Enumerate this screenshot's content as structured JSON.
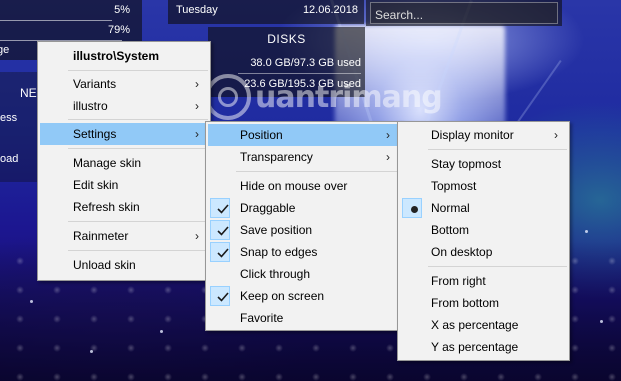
{
  "colors": {
    "menu_bg": "#f2f2f2",
    "highlight": "#91c9f7",
    "check_bg": "#cce8ff",
    "skin_bg": "#14141a"
  },
  "desktop": {
    "system_skin": {
      "rows": [
        {
          "key": "",
          "value": "5%"
        },
        {
          "key": "",
          "value": "79%"
        },
        {
          "key": "ge",
          "value": ""
        }
      ]
    },
    "net_skin": {
      "title": "NE",
      "lines": [
        "ess",
        "oad"
      ]
    },
    "date_skin": {
      "day": "Tuesday",
      "date": "12.06.2018"
    },
    "search_skin": {
      "placeholder": "Search..."
    },
    "disks_skin": {
      "title": "DISKS",
      "lines": [
        "38.0 GB/97.3 GB used",
        "23.6 GB/195.3 GB used"
      ]
    },
    "watermark": {
      "text": "uantrimang"
    }
  },
  "context_menu": {
    "title": "illustro\\System",
    "items": [
      {
        "label": "Variants",
        "submenu": true
      },
      {
        "label": "illustro",
        "submenu": true
      },
      {
        "label": "Settings",
        "submenu": true
      },
      {
        "label": "Manage skin"
      },
      {
        "label": "Edit skin"
      },
      {
        "label": "Refresh skin"
      },
      {
        "label": "Rainmeter",
        "submenu": true
      },
      {
        "label": "Unload skin"
      }
    ]
  },
  "settings_menu": {
    "items": [
      {
        "label": "Position",
        "submenu": true
      },
      {
        "label": "Transparency",
        "submenu": true
      },
      {
        "label": "Hide on mouse over",
        "checked": false
      },
      {
        "label": "Draggable",
        "checked": true
      },
      {
        "label": "Save position",
        "checked": true
      },
      {
        "label": "Snap to edges",
        "checked": true
      },
      {
        "label": "Click through",
        "checked": false
      },
      {
        "label": "Keep on screen",
        "checked": true
      },
      {
        "label": "Favorite",
        "checked": false
      }
    ]
  },
  "position_menu": {
    "items": [
      {
        "label": "Display monitor",
        "submenu": true
      },
      {
        "label": "Stay topmost"
      },
      {
        "label": "Topmost"
      },
      {
        "label": "Normal",
        "selected": true
      },
      {
        "label": "Bottom"
      },
      {
        "label": "On desktop"
      },
      {
        "label": "From right"
      },
      {
        "label": "From bottom"
      },
      {
        "label": "X as percentage"
      },
      {
        "label": "Y as percentage"
      }
    ]
  }
}
